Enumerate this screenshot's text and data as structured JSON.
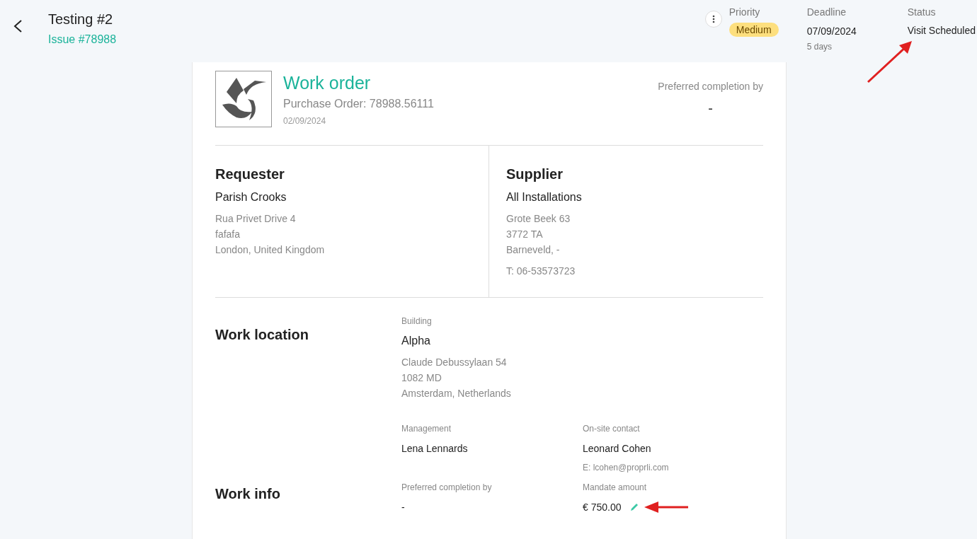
{
  "header": {
    "title": "Testing #2",
    "issue": "Issue #78988",
    "priority": {
      "label": "Priority",
      "value": "Medium"
    },
    "deadline": {
      "label": "Deadline",
      "value": "07/09/2024",
      "note": "5 days"
    },
    "status": {
      "label": "Status",
      "value": "Visit Scheduled"
    }
  },
  "order": {
    "title": "Work order",
    "purchase_order": "Purchase Order: 78988.56111",
    "date": "02/09/2024",
    "preferred_label": "Preferred completion by",
    "preferred_value": "-"
  },
  "parties": [
    {
      "heading": "Requester",
      "name": "Parish Crooks",
      "lines": [
        "Rua Privet Drive 4",
        "fafafa",
        "London, United Kingdom"
      ]
    },
    {
      "heading": "Supplier",
      "name": "All Installations",
      "lines": [
        "Grote Beek 63",
        "3772 TA",
        "Barneveld, -"
      ],
      "phone": "T: 06-53573723"
    }
  ],
  "work_location": {
    "heading": "Work location",
    "building_label": "Building",
    "building": "Alpha",
    "address": [
      "Claude Debussylaan 54",
      "1082 MD",
      "Amsterdam, Netherlands"
    ],
    "management_label": "Management",
    "management": "Lena Lennards",
    "contact_label": "On-site contact",
    "contact": "Leonard Cohen",
    "contact_email": "E: lcohen@proprli.com"
  },
  "work_info": {
    "heading": "Work info",
    "preferred_label": "Preferred completion by",
    "preferred_value": "-",
    "mandate_label": "Mandate amount",
    "mandate_value": "€ 750.00"
  }
}
